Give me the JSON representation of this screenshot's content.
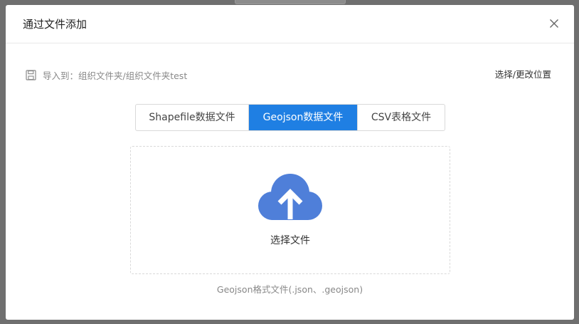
{
  "dialog": {
    "title": "通过文件添加",
    "close_icon": "close-icon"
  },
  "import": {
    "icon": "save-icon",
    "label": "导入到：组织文件夹/组织文件夹test",
    "change_location": "选择/更改位置"
  },
  "tabs": [
    {
      "label": "Shapefile数据文件",
      "active": false
    },
    {
      "label": "Geojson数据文件",
      "active": true
    },
    {
      "label": "CSV表格文件",
      "active": false
    }
  ],
  "dropzone": {
    "icon": "cloud-upload-icon",
    "label": "选择文件",
    "hint": "Geojson格式文件(.json、.geojson)"
  },
  "colors": {
    "accent": "#1f7fe3",
    "cloud": "#4f7fd9"
  }
}
